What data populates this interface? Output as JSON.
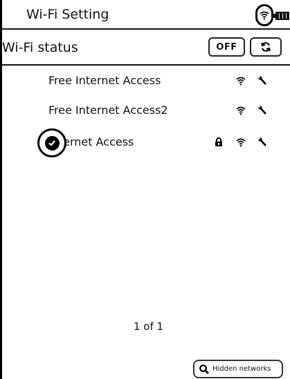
{
  "window": {
    "title": "Wi-Fi Setting"
  },
  "status_bar": {
    "wifi_icon": "wifi-icon",
    "battery_icon": "battery-icon"
  },
  "status": {
    "label": "Wi-Fi status",
    "toggle_label": "OFF",
    "refresh_icon": "refresh-icon"
  },
  "networks": [
    {
      "name": "Free Internet Access",
      "locked": false,
      "connected": false
    },
    {
      "name": "Free Internet Access2",
      "locked": false,
      "connected": false
    },
    {
      "name": "Internet Access",
      "locked": true,
      "connected": true
    }
  ],
  "pagination": {
    "text": "1 of 1"
  },
  "hidden_networks": {
    "label": "Hidden networks",
    "icon": "search-icon"
  }
}
